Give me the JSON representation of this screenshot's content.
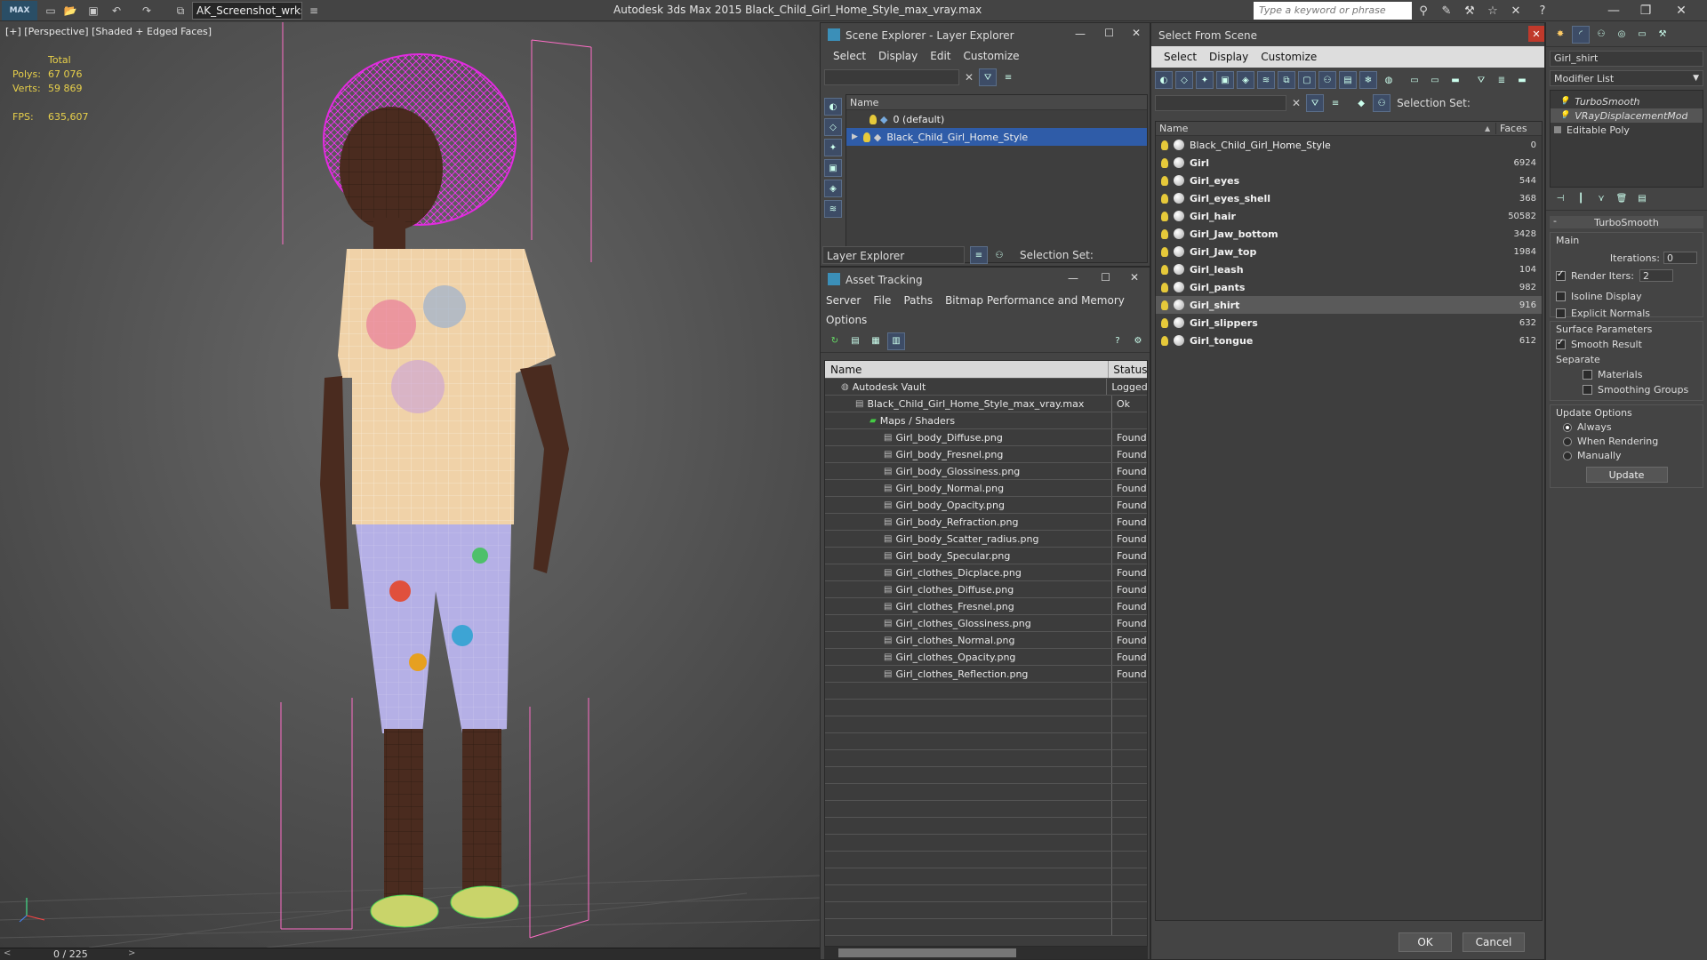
{
  "titlebar": {
    "logo": "MAX",
    "workspace": "AK_Screenshot_wrksp",
    "app_title": "Autodesk 3ds Max  2015    Black_Child_Girl_Home_Style_max_vray.max",
    "search_placeholder": "Type a keyword or phrase"
  },
  "viewport": {
    "label": "[+] [Perspective] [Shaded + Edged Faces]",
    "stats": {
      "total_label": "Total",
      "polys_label": "Polys:",
      "polys": "67 076",
      "verts_label": "Verts:",
      "verts": "59 869",
      "fps_label": "FPS:",
      "fps": "635,607"
    }
  },
  "timebar": {
    "frame": "0 / 225"
  },
  "scene_explorer": {
    "title": "Scene Explorer - Layer Explorer",
    "menu": [
      "Select",
      "Display",
      "Edit",
      "Customize"
    ],
    "col_name": "Name",
    "rows": [
      "0 (default)",
      "Black_Child_Girl_Home_Style"
    ],
    "footer_dropdown": "Layer Explorer",
    "footer_selset": "Selection Set:"
  },
  "asset_tracking": {
    "title": "Asset Tracking",
    "menu": [
      "Server",
      "File",
      "Paths",
      "Bitmap Performance and Memory"
    ],
    "menu2": "Options",
    "col_name": "Name",
    "col_status": "Status",
    "rows": [
      {
        "name": "Autodesk Vault",
        "status": "Logged",
        "indent": 0
      },
      {
        "name": "Black_Child_Girl_Home_Style_max_vray.max",
        "status": "Ok",
        "indent": 1
      },
      {
        "name": "Maps / Shaders",
        "status": "",
        "indent": 2
      },
      {
        "name": "Girl_body_Diffuse.png",
        "status": "Found",
        "indent": 3
      },
      {
        "name": "Girl_body_Fresnel.png",
        "status": "Found",
        "indent": 3
      },
      {
        "name": "Girl_body_Glossiness.png",
        "status": "Found",
        "indent": 3
      },
      {
        "name": "Girl_body_Normal.png",
        "status": "Found",
        "indent": 3
      },
      {
        "name": "Girl_body_Opacity.png",
        "status": "Found",
        "indent": 3
      },
      {
        "name": "Girl_body_Refraction.png",
        "status": "Found",
        "indent": 3
      },
      {
        "name": "Girl_body_Scatter_radius.png",
        "status": "Found",
        "indent": 3
      },
      {
        "name": "Girl_body_Specular.png",
        "status": "Found",
        "indent": 3
      },
      {
        "name": "Girl_clothes_Dicplace.png",
        "status": "Found",
        "indent": 3
      },
      {
        "name": "Girl_clothes_Diffuse.png",
        "status": "Found",
        "indent": 3
      },
      {
        "name": "Girl_clothes_Fresnel.png",
        "status": "Found",
        "indent": 3
      },
      {
        "name": "Girl_clothes_Glossiness.png",
        "status": "Found",
        "indent": 3
      },
      {
        "name": "Girl_clothes_Normal.png",
        "status": "Found",
        "indent": 3
      },
      {
        "name": "Girl_clothes_Opacity.png",
        "status": "Found",
        "indent": 3
      },
      {
        "name": "Girl_clothes_Reflection.png",
        "status": "Found",
        "indent": 3
      }
    ]
  },
  "select_from_scene": {
    "title": "Select From Scene",
    "menu": [
      "Select",
      "Display",
      "Customize"
    ],
    "selset": "Selection Set:",
    "col_name": "Name",
    "col_faces": "Faces",
    "rows": [
      {
        "name": "Black_Child_Girl_Home_Style",
        "faces": "0"
      },
      {
        "name": "Girl",
        "faces": "6924"
      },
      {
        "name": "Girl_eyes",
        "faces": "544"
      },
      {
        "name": "Girl_eyes_shell",
        "faces": "368"
      },
      {
        "name": "Girl_hair",
        "faces": "50582"
      },
      {
        "name": "Girl_Jaw_bottom",
        "faces": "3428"
      },
      {
        "name": "Girl_Jaw_top",
        "faces": "1984"
      },
      {
        "name": "Girl_leash",
        "faces": "104"
      },
      {
        "name": "Girl_pants",
        "faces": "982"
      },
      {
        "name": "Girl_shirt",
        "faces": "916"
      },
      {
        "name": "Girl_slippers",
        "faces": "632"
      },
      {
        "name": "Girl_tongue",
        "faces": "612"
      }
    ],
    "ok": "OK",
    "cancel": "Cancel"
  },
  "modify_panel": {
    "object_name": "Girl_shirt",
    "modifier_list": "Modifier List",
    "stack": [
      "TurboSmooth",
      "VRayDisplacementMod",
      "Editable Poly"
    ],
    "rollout_title": "TurboSmooth",
    "main_label": "Main",
    "iterations_label": "Iterations:",
    "iterations": "0",
    "render_iters_label": "Render Iters:",
    "render_iters": "2",
    "isoline": "Isoline Display",
    "explicit": "Explicit Normals",
    "surface_label": "Surface Parameters",
    "smooth_result": "Smooth Result",
    "separate": "Separate",
    "materials": "Materials",
    "smoothing_groups": "Smoothing Groups",
    "update_options": "Update Options",
    "always": "Always",
    "when_rendering": "When Rendering",
    "manually": "Manually",
    "update": "Update"
  }
}
